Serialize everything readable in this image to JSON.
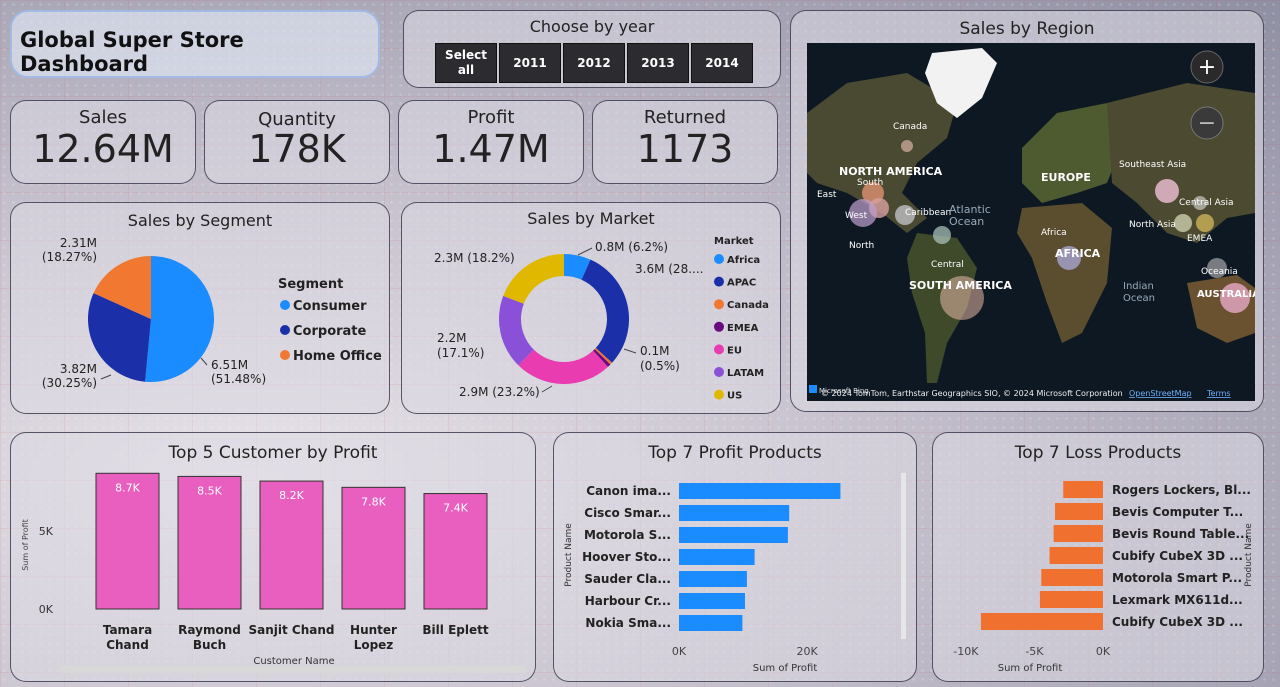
{
  "dashboard": {
    "title": "Global Super Store Dashboard"
  },
  "year_filter": {
    "title": "Choose by year",
    "buttons": [
      "Select all",
      "2011",
      "2012",
      "2013",
      "2014"
    ]
  },
  "kpis": [
    {
      "label": "Sales",
      "value": "12.64M"
    },
    {
      "label": "Quantity",
      "value": "178K"
    },
    {
      "label": "Profit",
      "value": "1.47M"
    },
    {
      "label": "Returned",
      "value": "1173"
    }
  ],
  "map": {
    "title": "Sales by Region",
    "labels": [
      "Canada",
      "NORTH AMERICA",
      "East",
      "South",
      "West",
      "North",
      "Caribbean",
      "Atlantic Ocean",
      "Central",
      "SOUTH AMERICA",
      "EUROPE",
      "Africa",
      "AFRICA",
      "Southeast Asia",
      "Central Asia",
      "North Asia",
      "EMEA",
      "Oceania",
      "Indian Ocean",
      "AUSTRALIA"
    ],
    "attribution": "© 2024 TomTom, Earthstar Geographics SIO, © 2024 Microsoft Corporation",
    "attribution_link1": "OpenStreetMap",
    "attribution_link2": "Terms",
    "logo_text": "Microsoft Bing",
    "zoom_in": "+",
    "zoom_out": "−"
  },
  "colors": {
    "consumer": "#1a8cff",
    "corporate": "#1a2fa8",
    "home_office": "#f07830",
    "africa": "#1a8cff",
    "apac": "#1a2fa8",
    "canada": "#f07830",
    "emea": "#6a0a80",
    "eu": "#e83cb0",
    "latam": "#8a50d8",
    "us": "#e0b800",
    "customer_bar": "#e85fbf",
    "profit_bar": "#1a8cff",
    "loss_bar": "#f07030"
  },
  "chart_data": [
    {
      "type": "pie",
      "title": "Sales by Segment",
      "legend_title": "Segment",
      "categories": [
        "Consumer",
        "Corporate",
        "Home Office"
      ],
      "values": [
        6.51,
        3.82,
        2.31
      ],
      "labels": [
        "6.51M\n(51.48%)",
        "3.82M\n(30.25%)",
        "2.31M\n(18.27%)"
      ]
    },
    {
      "type": "pie",
      "title": "Sales by Market",
      "legend_title": "Market",
      "categories": [
        "Africa",
        "APAC",
        "Canada",
        "EMEA",
        "EU",
        "LATAM",
        "US"
      ],
      "values": [
        0.8,
        3.6,
        0.07,
        0.1,
        2.9,
        2.2,
        2.3
      ],
      "labels": [
        "0.8M (6.2%)",
        "3.6M (28....",
        "",
        "0.1M\n(0.5%)",
        "2.9M (23.2%)",
        "2.2M\n(17.1%)",
        "2.3M (18.2%)"
      ]
    },
    {
      "type": "bar",
      "title": "Top 5 Customer by Profit",
      "categories": [
        "Tamara\nChand",
        "Raymond\nBuch",
        "Sanjit Chand",
        "Hunter\nLopez",
        "Bill Eplett"
      ],
      "values": [
        8.7,
        8.5,
        8.2,
        7.8,
        7.4
      ],
      "data_labels": [
        "8.7K",
        "8.5K",
        "8.2K",
        "7.8K",
        "7.4K"
      ],
      "xlabel": "Customer Name",
      "ylabel": "Sum of Profit",
      "yticks": [
        "0K",
        "5K"
      ],
      "ylim": [
        0,
        10
      ]
    },
    {
      "type": "bar",
      "orientation": "horizontal",
      "title": "Top 7 Profit Products",
      "categories": [
        "Canon ima...",
        "Cisco Smar...",
        "Motorola S...",
        "Hoover Sto...",
        "Sauder Cla...",
        "Harbour Cr...",
        "Nokia Sma..."
      ],
      "values": [
        25.2,
        17.2,
        17.0,
        11.8,
        10.6,
        10.3,
        9.9
      ],
      "xlabel": "Sum of Profit",
      "ylabel": "Product Name",
      "xticks": [
        "0K",
        "20K"
      ],
      "xlim": [
        0,
        32
      ]
    },
    {
      "type": "bar",
      "orientation": "horizontal",
      "title": "Top 7 Loss Products",
      "categories": [
        "Rogers Lockers, Bl...",
        "Bevis Computer T...",
        "Bevis Round Table...",
        "Cubify CubeX 3D ...",
        "Motorola Smart P...",
        "Lexmark MX611d...",
        "Cubify CubeX 3D ..."
      ],
      "values": [
        -2.9,
        -3.5,
        -3.6,
        -3.9,
        -4.5,
        -4.6,
        -8.9
      ],
      "xlabel": "Sum of Profit",
      "ylabel": "Product Name",
      "xticks": [
        "-10K",
        "-5K",
        "0K"
      ],
      "xlim": [
        -10.5,
        0
      ]
    }
  ]
}
